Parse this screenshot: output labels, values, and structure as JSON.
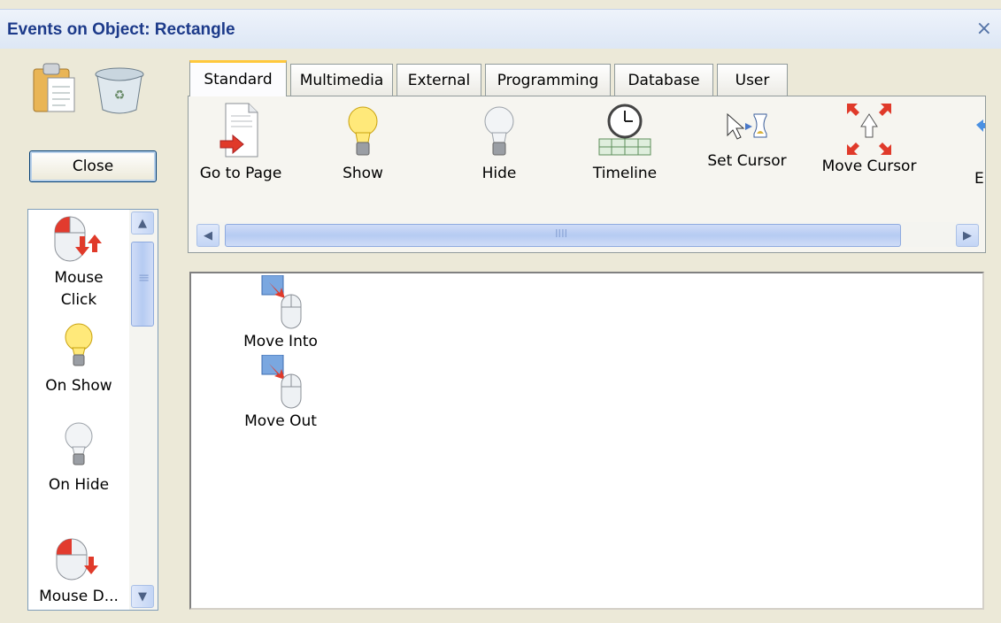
{
  "window": {
    "title": "Events on Object: Rectangle",
    "close_glyph": "×"
  },
  "toolbar": {
    "paste_icon": "clipboard-icon",
    "delete_icon": "recycle-bin-icon",
    "close_label": "Close"
  },
  "events_list": {
    "items": [
      {
        "label": "Mouse Click",
        "icon": "mouse-click-icon"
      },
      {
        "label": "On Show",
        "icon": "lightbulb-on-icon"
      },
      {
        "label": "On Hide",
        "icon": "lightbulb-off-icon"
      },
      {
        "label": "Mouse D...",
        "icon": "mouse-down-icon"
      }
    ]
  },
  "tabs": [
    {
      "label": "Standard",
      "active": true
    },
    {
      "label": "Multimedia",
      "active": false
    },
    {
      "label": "External",
      "active": false
    },
    {
      "label": "Programming",
      "active": false
    },
    {
      "label": "Database",
      "active": false
    },
    {
      "label": "User",
      "active": false
    }
  ],
  "actions": [
    {
      "label": "Go to Page",
      "icon": "go-to-page-icon"
    },
    {
      "label": "Show",
      "icon": "lightbulb-on-icon"
    },
    {
      "label": "Hide",
      "icon": "lightbulb-off-icon"
    },
    {
      "label": "Timeline",
      "icon": "timeline-clock-icon"
    },
    {
      "label": "Set Cursor",
      "icon": "set-cursor-icon"
    },
    {
      "label": "Move Cursor",
      "icon": "move-cursor-icon"
    },
    {
      "label": "E",
      "icon": "partial-icon"
    }
  ],
  "canvas": {
    "items": [
      {
        "label": "Move Into",
        "icon": "move-into-icon"
      },
      {
        "label": "Move Out",
        "icon": "move-out-icon"
      }
    ]
  },
  "colors": {
    "title_text": "#1c3a8a",
    "active_tab_accent": "#ffc83c",
    "scrollbar_blue": "#b6cbf2",
    "window_bg": "#ece9d8"
  }
}
